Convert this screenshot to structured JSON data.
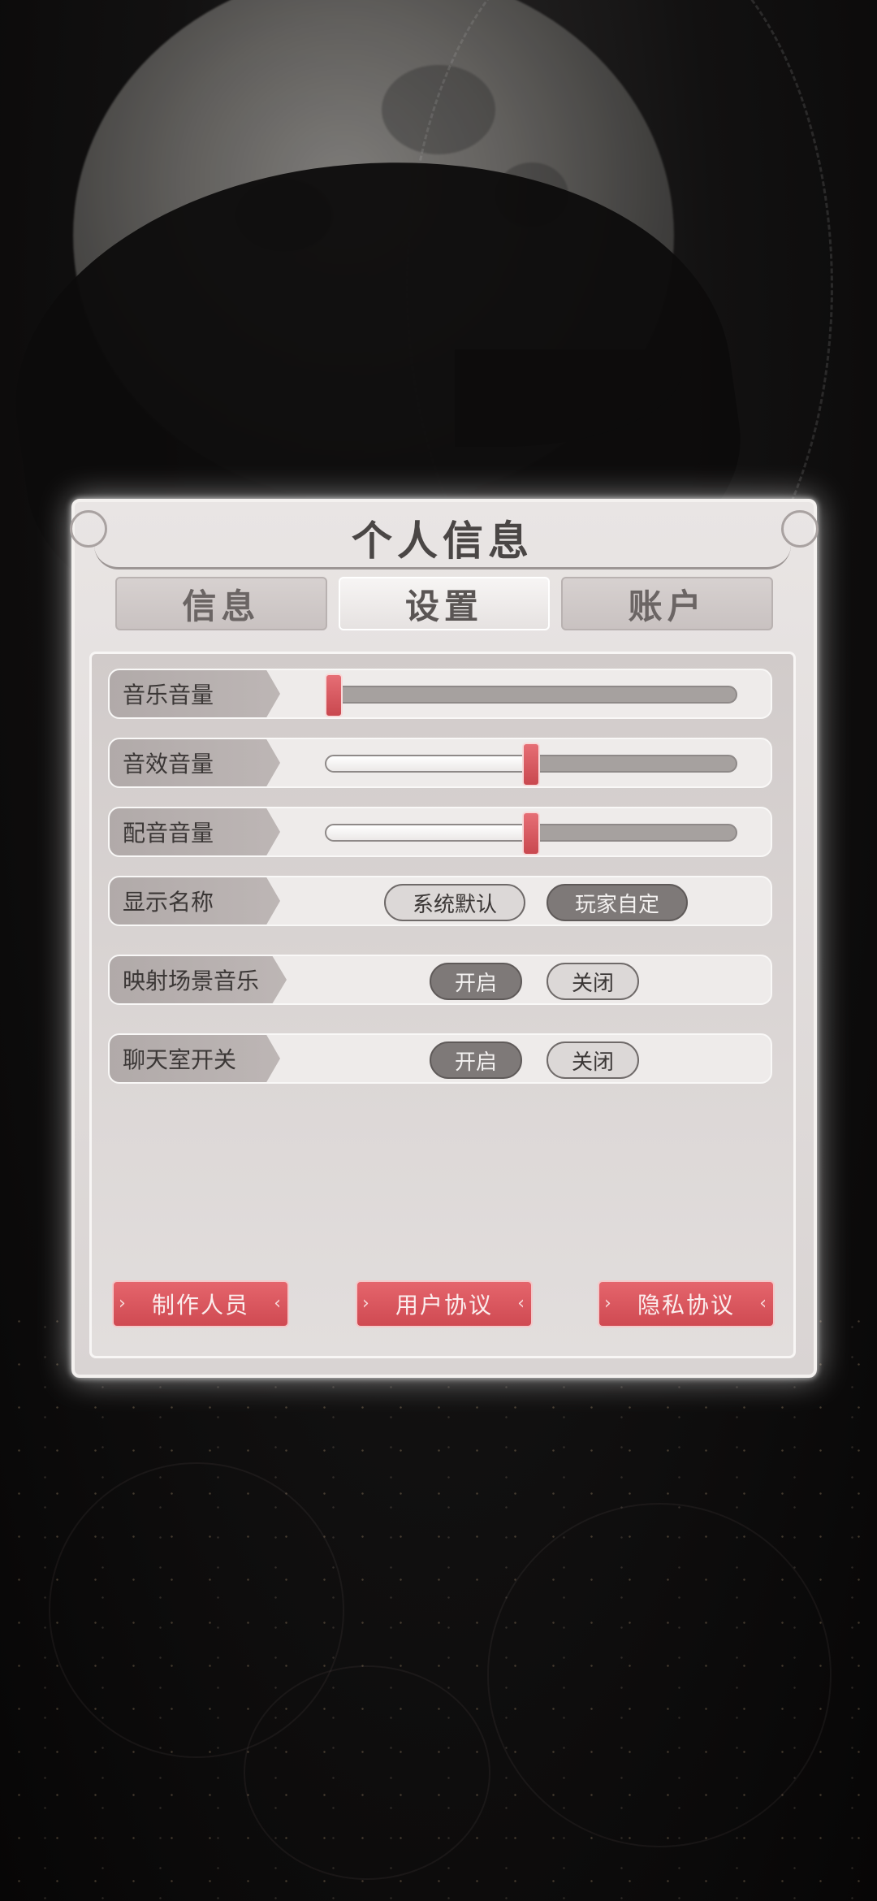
{
  "panel": {
    "title": "个人信息",
    "tabs": [
      {
        "label": "信息",
        "active": false
      },
      {
        "label": "设置",
        "active": true
      },
      {
        "label": "账户",
        "active": false
      }
    ]
  },
  "settings": {
    "music_volume": {
      "label": "音乐音量",
      "value": 0.0
    },
    "sfx_volume": {
      "label": "音效音量",
      "value": 0.5
    },
    "voice_volume": {
      "label": "配音音量",
      "value": 0.5
    },
    "display_name": {
      "label": "显示名称",
      "options": [
        "系统默认",
        "玩家自定"
      ],
      "selected": "玩家自定"
    },
    "scene_music": {
      "label": "映射场景音乐",
      "options": [
        "开启",
        "关闭"
      ],
      "selected": "开启"
    },
    "chatroom": {
      "label": "聊天室开关",
      "options": [
        "开启",
        "关闭"
      ],
      "selected": "开启"
    }
  },
  "footer": {
    "credits_label": "制作人员",
    "user_agreement_label": "用户协议",
    "privacy_label": "隐私协议"
  },
  "colors": {
    "accent": "#d9545b",
    "panel_bg": "#e6e2e1",
    "selected_pill": "#7e7978"
  }
}
